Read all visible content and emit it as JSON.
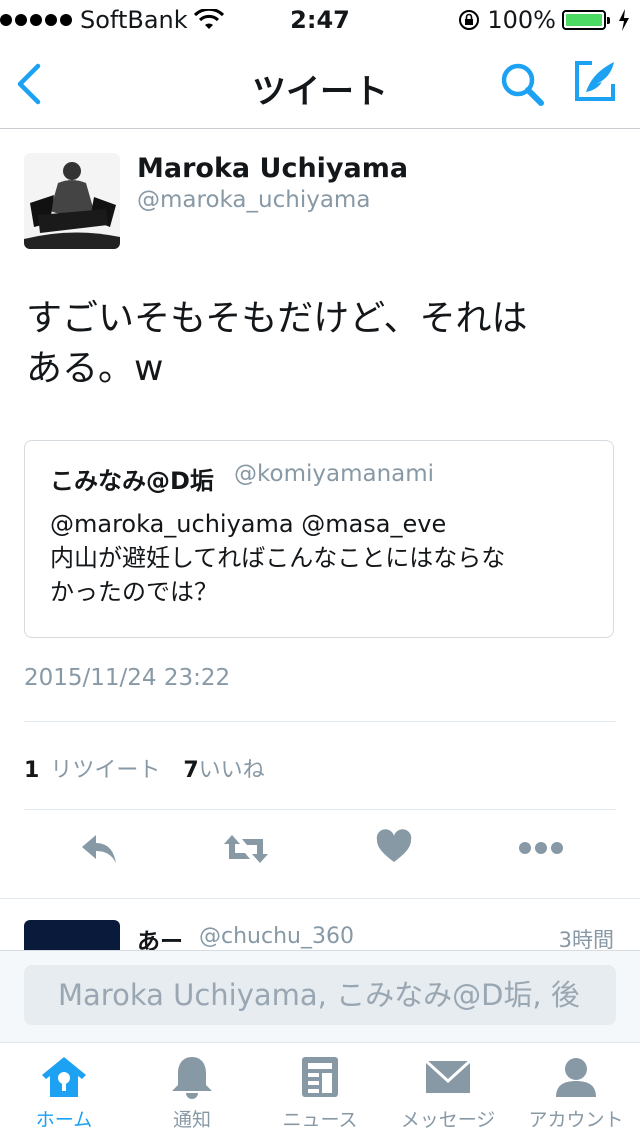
{
  "status_bar": {
    "carrier": "SoftBank",
    "time": "2:47",
    "battery": "100%",
    "battery_level": 1.0
  },
  "nav": {
    "title": "ツイート"
  },
  "tweet": {
    "name": "Maroka Uchiyama",
    "handle": "@maroka_uchiyama",
    "text_line1": "すごいそもそもだけど、それは",
    "text_line2": "ある。w",
    "timestamp": "2015/11/24 23:22",
    "retweet_count": "1",
    "retweet_label": "リツイート",
    "like_count": "7",
    "like_label": "いいね"
  },
  "quoted": {
    "name": "こみなみ@D垢",
    "handle": "@komiyamanami",
    "line1": "@maroka_uchiyama @masa_eve",
    "line2": "内山が避妊してればこんなことにはならな",
    "line3": "かったのでは？"
  },
  "reply": {
    "name": "あー",
    "handle": "@chuchu_360",
    "time": "3時間"
  },
  "composer": {
    "placeholder": "Maroka Uchiyama, こみなみ@D垢, 後"
  },
  "tabs": [
    {
      "label": "ホーム",
      "icon": "home-icon",
      "active": true
    },
    {
      "label": "通知",
      "icon": "bell-icon"
    },
    {
      "label": "ニュース",
      "icon": "news-icon"
    },
    {
      "label": "メッセージ",
      "icon": "envelope-icon"
    },
    {
      "label": "アカウント",
      "icon": "person-icon"
    }
  ],
  "colors": {
    "accent": "#1da1f2",
    "muted": "#8899a6",
    "battery": "#4cd964"
  }
}
